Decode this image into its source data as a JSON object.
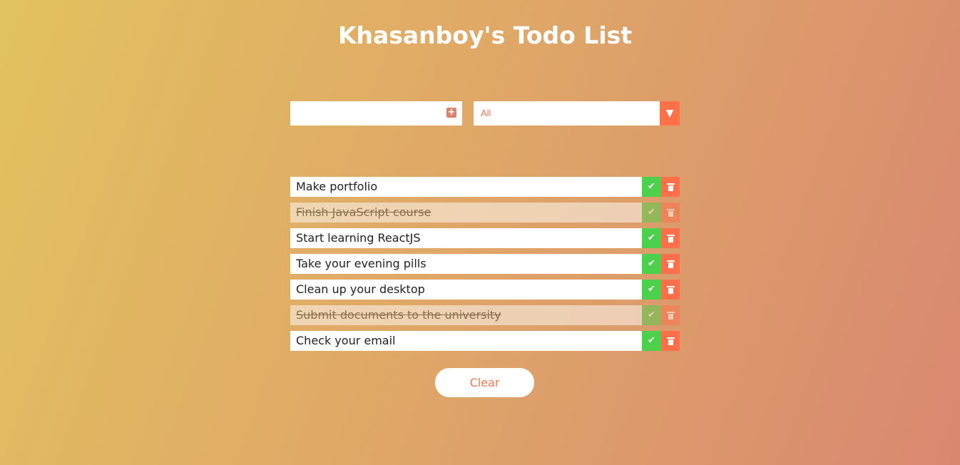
{
  "header": {
    "title": "Khasanboy's Todo List"
  },
  "input": {
    "value": "",
    "placeholder": "",
    "add_icon": "plus-square-icon"
  },
  "filter": {
    "selected": "All",
    "arrow_icon": "triangle-down-icon"
  },
  "todos": [
    {
      "text": "Make portfolio",
      "done": false
    },
    {
      "text": "Finish JavaScript course",
      "done": true
    },
    {
      "text": "Start learning ReactJS",
      "done": false
    },
    {
      "text": "Take your evening pills",
      "done": false
    },
    {
      "text": "Clean up your desktop",
      "done": false
    },
    {
      "text": "Submit documents to the university",
      "done": true
    },
    {
      "text": "Check your email",
      "done": false
    }
  ],
  "actions": {
    "check_icon": "check-icon",
    "delete_icon": "trash-icon"
  },
  "footer": {
    "clear_label": "Clear"
  },
  "colors": {
    "accent": "#ff7146",
    "check": "#4cd14c"
  }
}
